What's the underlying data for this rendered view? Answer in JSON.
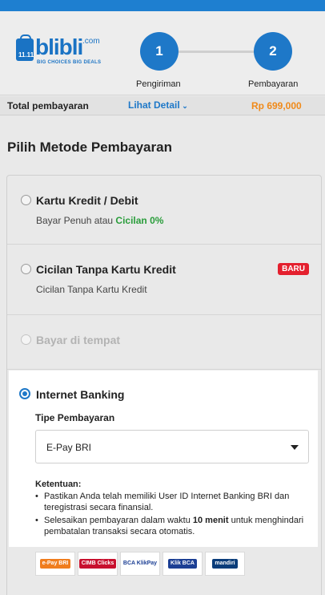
{
  "header": {
    "logo": {
      "word": "blibli",
      "com": ".com",
      "tagline": "BIG CHOICES  BIG DEALS",
      "bag_number": "11.11"
    },
    "steps": [
      {
        "number": "1",
        "label": "Pengiriman"
      },
      {
        "number": "2",
        "label": "Pembayaran"
      }
    ]
  },
  "total": {
    "label": "Total pembayaran",
    "detail_link": "Lihat Detail",
    "amount": "Rp 699,000"
  },
  "section_title": "Pilih Metode Pembayaran",
  "methods": [
    {
      "title": "Kartu Kredit / Debit",
      "sub_prefix": "Bayar Penuh atau ",
      "sub_highlight": "Cicilan 0%"
    },
    {
      "title": "Cicilan Tanpa Kartu Kredit",
      "subtitle": "Cicilan Tanpa Kartu Kredit",
      "badge": "BARU"
    },
    {
      "title": "Bayar di tempat",
      "disabled": true
    }
  ],
  "selected_method": {
    "title": "Internet Banking",
    "type_label": "Tipe Pembayaran",
    "select_value": "E-Pay BRI",
    "terms_title": "Ketentuan:",
    "term1": "Pastikan Anda telah memiliki User ID Internet Banking BRI dan teregistrasi secara finansial.",
    "term2_pre": "Selesaikan pembayaran dalam waktu ",
    "term2_bold": "10 menit",
    "term2_post": " untuk menghindari pembatalan transaksi secara otomatis."
  },
  "bank_logos": [
    {
      "name": "e-Pay BRI",
      "icon": "epay-bri-logo",
      "color": "#f07d1e"
    },
    {
      "name": "CIMB Clicks",
      "icon": "cimb-clicks-logo",
      "color": "#c8102e"
    },
    {
      "name": "BCA KlikPay",
      "icon": "bca-klikpay-logo",
      "color": "#1c3f94"
    },
    {
      "name": "Klik BCA",
      "icon": "klik-bca-logo",
      "color": "#1c3f94"
    },
    {
      "name": "mandiri",
      "icon": "mandiri-clickpay-logo",
      "color": "#0a3d7a"
    }
  ],
  "colors": {
    "primary": "#1e78c8",
    "amount": "#f08a1a",
    "badge": "#e4202e",
    "cicilan": "#2a9d3b"
  }
}
